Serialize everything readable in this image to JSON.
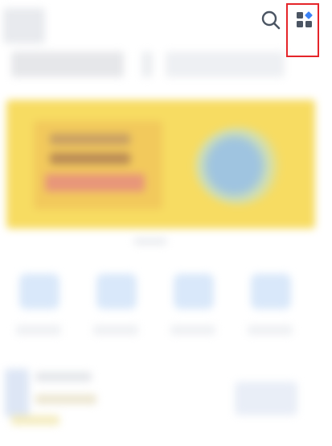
{
  "header": {
    "search_icon": "search-icon",
    "apps_icon": "apps-grid-icon"
  },
  "colors": {
    "icon": "#4b5563",
    "icon_accent": "#3b82f6",
    "highlight": "#e5252a",
    "banner": "#f7dc62"
  }
}
